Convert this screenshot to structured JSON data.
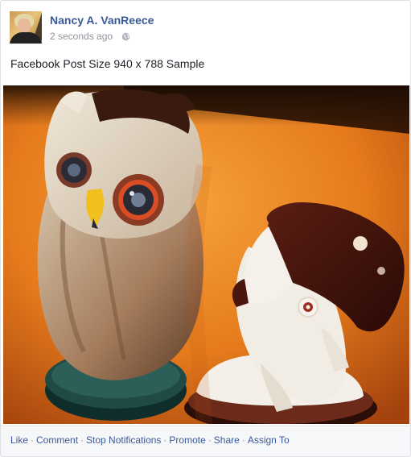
{
  "post": {
    "author_name": "Nancy A. VanReece",
    "timestamp": "2 seconds ago",
    "privacy_icon": "globe-icon",
    "text": "Facebook Post Size 940 x 788 Sample"
  },
  "actions": {
    "like": "Like",
    "comment": "Comment",
    "stop_notifications": "Stop Notifications",
    "promote": "Promote",
    "share": "Share",
    "assign_to": "Assign To",
    "separator": "·"
  },
  "colors": {
    "link": "#3b5998",
    "muted": "#90949c",
    "footer_bg": "#f6f7f9"
  }
}
